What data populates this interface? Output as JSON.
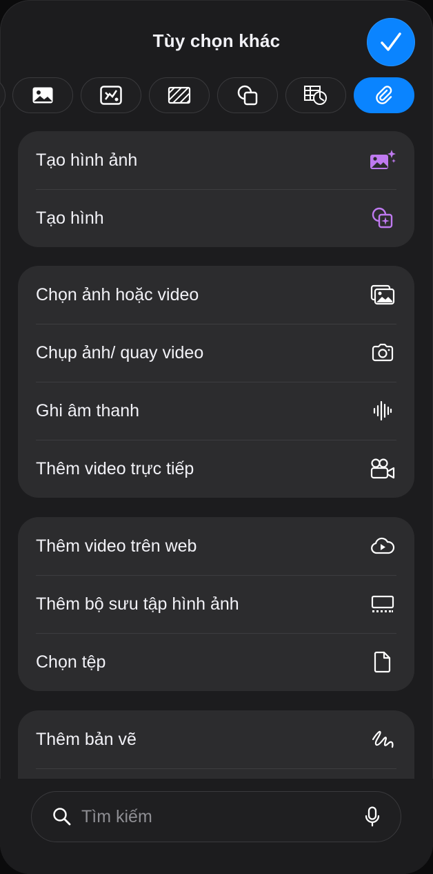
{
  "header": {
    "title": "Tùy chọn khác",
    "done_icon": "checkmark-icon"
  },
  "tabs": [
    {
      "icon": "partial-tab-icon"
    },
    {
      "icon": "image-icon"
    },
    {
      "icon": "chart-image-icon"
    },
    {
      "icon": "hatched-rectangle-icon"
    },
    {
      "icon": "shapes-icon"
    },
    {
      "icon": "table-chart-icon"
    },
    {
      "icon": "paperclip-icon",
      "active": true
    }
  ],
  "groups": [
    {
      "items": [
        {
          "label": "Tạo hình ảnh",
          "icon": "image-sparkle-icon"
        },
        {
          "label": "Tạo hình",
          "icon": "shape-sparkle-icon"
        }
      ]
    },
    {
      "items": [
        {
          "label": "Chọn ảnh hoặc video",
          "icon": "photos-icon"
        },
        {
          "label": "Chụp ảnh/ quay video",
          "icon": "camera-icon"
        },
        {
          "label": "Ghi âm thanh",
          "icon": "waveform-icon"
        },
        {
          "label": "Thêm video trực tiếp",
          "icon": "video-camera-icon"
        }
      ]
    },
    {
      "items": [
        {
          "label": "Thêm video trên web",
          "icon": "cloud-play-icon"
        },
        {
          "label": "Thêm bộ sưu tập hình ảnh",
          "icon": "gallery-icon"
        },
        {
          "label": "Chọn tệp",
          "icon": "document-icon"
        }
      ]
    },
    {
      "items": [
        {
          "label": "Thêm bản vẽ",
          "icon": "scribble-icon"
        }
      ]
    }
  ],
  "search": {
    "placeholder": "Tìm kiếm",
    "icon": "search-icon",
    "mic_icon": "microphone-icon"
  },
  "colors": {
    "accent": "#0a84ff",
    "purple": "#bf7af0",
    "background": "#1c1c1e",
    "card": "#2c2c2e"
  }
}
